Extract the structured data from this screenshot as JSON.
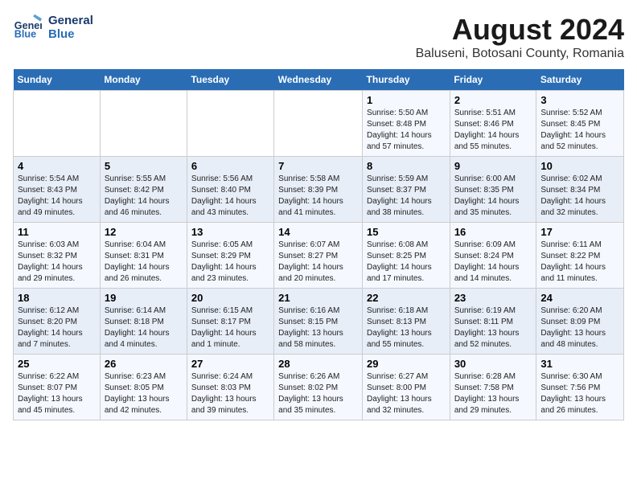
{
  "header": {
    "logo_line1": "General",
    "logo_line2": "Blue",
    "main_title": "August 2024",
    "subtitle": "Baluseni, Botosani County, Romania"
  },
  "days_of_week": [
    "Sunday",
    "Monday",
    "Tuesday",
    "Wednesday",
    "Thursday",
    "Friday",
    "Saturday"
  ],
  "weeks": [
    [
      {
        "day": "",
        "info": ""
      },
      {
        "day": "",
        "info": ""
      },
      {
        "day": "",
        "info": ""
      },
      {
        "day": "",
        "info": ""
      },
      {
        "day": "1",
        "info": "Sunrise: 5:50 AM\nSunset: 8:48 PM\nDaylight: 14 hours\nand 57 minutes."
      },
      {
        "day": "2",
        "info": "Sunrise: 5:51 AM\nSunset: 8:46 PM\nDaylight: 14 hours\nand 55 minutes."
      },
      {
        "day": "3",
        "info": "Sunrise: 5:52 AM\nSunset: 8:45 PM\nDaylight: 14 hours\nand 52 minutes."
      }
    ],
    [
      {
        "day": "4",
        "info": "Sunrise: 5:54 AM\nSunset: 8:43 PM\nDaylight: 14 hours\nand 49 minutes."
      },
      {
        "day": "5",
        "info": "Sunrise: 5:55 AM\nSunset: 8:42 PM\nDaylight: 14 hours\nand 46 minutes."
      },
      {
        "day": "6",
        "info": "Sunrise: 5:56 AM\nSunset: 8:40 PM\nDaylight: 14 hours\nand 43 minutes."
      },
      {
        "day": "7",
        "info": "Sunrise: 5:58 AM\nSunset: 8:39 PM\nDaylight: 14 hours\nand 41 minutes."
      },
      {
        "day": "8",
        "info": "Sunrise: 5:59 AM\nSunset: 8:37 PM\nDaylight: 14 hours\nand 38 minutes."
      },
      {
        "day": "9",
        "info": "Sunrise: 6:00 AM\nSunset: 8:35 PM\nDaylight: 14 hours\nand 35 minutes."
      },
      {
        "day": "10",
        "info": "Sunrise: 6:02 AM\nSunset: 8:34 PM\nDaylight: 14 hours\nand 32 minutes."
      }
    ],
    [
      {
        "day": "11",
        "info": "Sunrise: 6:03 AM\nSunset: 8:32 PM\nDaylight: 14 hours\nand 29 minutes."
      },
      {
        "day": "12",
        "info": "Sunrise: 6:04 AM\nSunset: 8:31 PM\nDaylight: 14 hours\nand 26 minutes."
      },
      {
        "day": "13",
        "info": "Sunrise: 6:05 AM\nSunset: 8:29 PM\nDaylight: 14 hours\nand 23 minutes."
      },
      {
        "day": "14",
        "info": "Sunrise: 6:07 AM\nSunset: 8:27 PM\nDaylight: 14 hours\nand 20 minutes."
      },
      {
        "day": "15",
        "info": "Sunrise: 6:08 AM\nSunset: 8:25 PM\nDaylight: 14 hours\nand 17 minutes."
      },
      {
        "day": "16",
        "info": "Sunrise: 6:09 AM\nSunset: 8:24 PM\nDaylight: 14 hours\nand 14 minutes."
      },
      {
        "day": "17",
        "info": "Sunrise: 6:11 AM\nSunset: 8:22 PM\nDaylight: 14 hours\nand 11 minutes."
      }
    ],
    [
      {
        "day": "18",
        "info": "Sunrise: 6:12 AM\nSunset: 8:20 PM\nDaylight: 14 hours\nand 7 minutes."
      },
      {
        "day": "19",
        "info": "Sunrise: 6:14 AM\nSunset: 8:18 PM\nDaylight: 14 hours\nand 4 minutes."
      },
      {
        "day": "20",
        "info": "Sunrise: 6:15 AM\nSunset: 8:17 PM\nDaylight: 14 hours\nand 1 minute."
      },
      {
        "day": "21",
        "info": "Sunrise: 6:16 AM\nSunset: 8:15 PM\nDaylight: 13 hours\nand 58 minutes."
      },
      {
        "day": "22",
        "info": "Sunrise: 6:18 AM\nSunset: 8:13 PM\nDaylight: 13 hours\nand 55 minutes."
      },
      {
        "day": "23",
        "info": "Sunrise: 6:19 AM\nSunset: 8:11 PM\nDaylight: 13 hours\nand 52 minutes."
      },
      {
        "day": "24",
        "info": "Sunrise: 6:20 AM\nSunset: 8:09 PM\nDaylight: 13 hours\nand 48 minutes."
      }
    ],
    [
      {
        "day": "25",
        "info": "Sunrise: 6:22 AM\nSunset: 8:07 PM\nDaylight: 13 hours\nand 45 minutes."
      },
      {
        "day": "26",
        "info": "Sunrise: 6:23 AM\nSunset: 8:05 PM\nDaylight: 13 hours\nand 42 minutes."
      },
      {
        "day": "27",
        "info": "Sunrise: 6:24 AM\nSunset: 8:03 PM\nDaylight: 13 hours\nand 39 minutes."
      },
      {
        "day": "28",
        "info": "Sunrise: 6:26 AM\nSunset: 8:02 PM\nDaylight: 13 hours\nand 35 minutes."
      },
      {
        "day": "29",
        "info": "Sunrise: 6:27 AM\nSunset: 8:00 PM\nDaylight: 13 hours\nand 32 minutes."
      },
      {
        "day": "30",
        "info": "Sunrise: 6:28 AM\nSunset: 7:58 PM\nDaylight: 13 hours\nand 29 minutes."
      },
      {
        "day": "31",
        "info": "Sunrise: 6:30 AM\nSunset: 7:56 PM\nDaylight: 13 hours\nand 26 minutes."
      }
    ]
  ]
}
